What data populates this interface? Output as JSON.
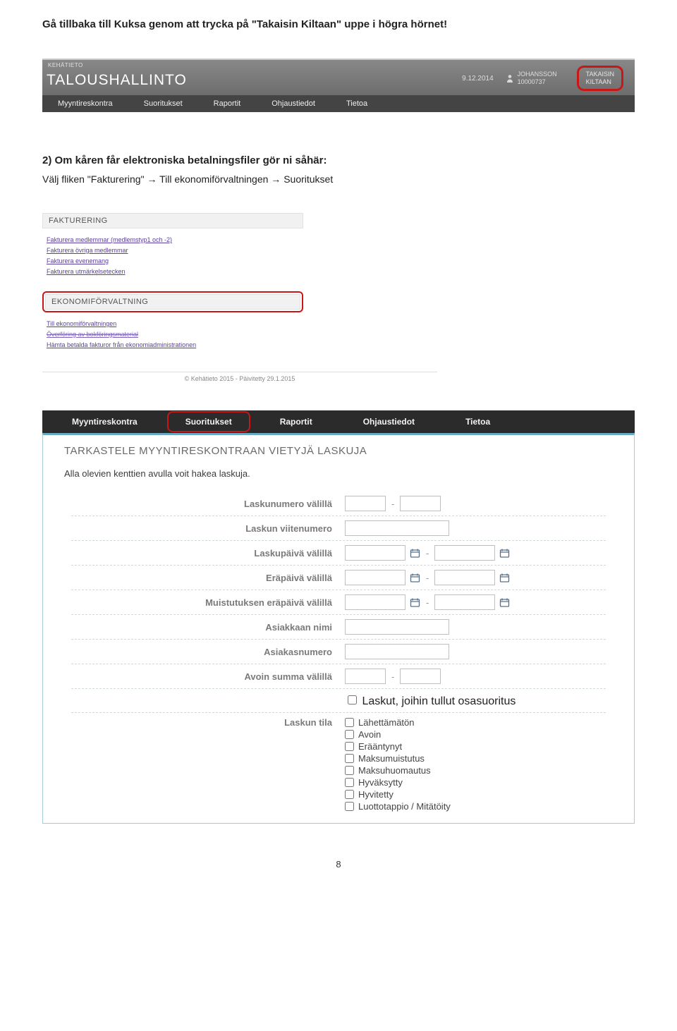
{
  "doc": {
    "line1": "Gå tillbaka till Kuksa genom att trycka på \"Takaisin Kiltaan\" uppe i högra hörnet!",
    "h2": "2) Om kåren får elektroniska betalningsfiler gör ni såhär:",
    "line2": "Välj fliken \"Fakturering\" → Till ekonomiförvaltningen → Suoritukset",
    "page_num": "8"
  },
  "ss1": {
    "breadcrumb": "KEHÄTIETO",
    "title": "TALOUSHALLINTO",
    "date": "9.12.2014",
    "user_name": "JOHANSSON",
    "user_id": "10000737",
    "back_line1": "TAKAISIN",
    "back_line2": "KILTAAN",
    "menu": [
      "Myyntireskontra",
      "Suoritukset",
      "Raportit",
      "Ohjaustiedot",
      "Tietoa"
    ]
  },
  "ss2": {
    "fakt_title": "FAKTURERING",
    "fakt_links": [
      "Fakturera medlemmar (medlemstyp1 och -2)",
      "Fakturera övriga medlemmar",
      "Fakturera evenemang",
      "Fakturera utmärkelsetecken"
    ],
    "eko_title": "EKONOMIFÖRVALTNING",
    "eko_links": [
      "Till ekonomiförvaltningen",
      "Överföring av bokföringsmaterial",
      "Hämta betalda fakturor från ekonomiadministrationen"
    ],
    "footer": "© Kehätieto 2015 - Päivitetty 29.1.2015"
  },
  "ss3": {
    "menu": [
      "Myyntireskontra",
      "Suoritukset",
      "Raportit",
      "Ohjaustiedot",
      "Tietoa"
    ],
    "heading": "TARKASTELE MYYNTIRESKONTRAAN VIETYJÄ LASKUJA",
    "sub": "Alla olevien kenttien avulla voit hakea laskuja.",
    "labels": {
      "laskunumero": "Laskunumero välillä",
      "viitenumero": "Laskun viitenumero",
      "laskupaiva": "Laskupäivä välillä",
      "erapaiva": "Eräpäivä välillä",
      "muistutus": "Muistutuksen eräpäivä välillä",
      "asiakasnimi": "Asiakkaan nimi",
      "asiakasnumero": "Asiakasnumero",
      "avoinsumma": "Avoin summa välillä",
      "osasuoritus": "Laskut, joihin tullut osasuoritus",
      "laskuntila": "Laskun tila"
    },
    "tila_options": [
      "Lähettämätön",
      "Avoin",
      "Erääntynyt",
      "Maksumuistutus",
      "Maksuhuomautus",
      "Hyväksytty",
      "Hyvitetty",
      "Luottotappio / Mitätöity"
    ]
  }
}
